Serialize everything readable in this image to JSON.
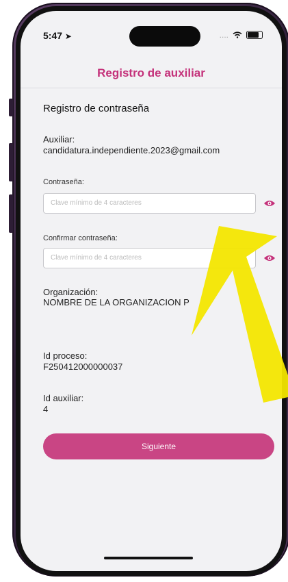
{
  "status_bar": {
    "time": "5:47",
    "signal": "....",
    "wifi": "wifi-icon",
    "battery": "battery-icon"
  },
  "header": {
    "title": "Registro de auxiliar"
  },
  "main": {
    "section_title": "Registro de contraseña",
    "auxiliar_label": "Auxiliar:",
    "auxiliar_value": "candidatura.independiente.2023@gmail.com",
    "password_label": "Contraseña:",
    "password_placeholder": "Clave mínimo de 4 caracteres",
    "confirm_label": "Confirmar contraseña:",
    "confirm_placeholder": "Clave mínimo de 4 caracteres",
    "organization_label": "Organización:",
    "organization_value": "NOMBRE DE LA ORGANIZACION P",
    "process_label": "Id proceso:",
    "process_value": "F250412000000037",
    "aux_id_label": "Id auxiliar:",
    "aux_id_value": "4",
    "next_button": "Siguiente"
  },
  "colors": {
    "accent": "#c94584",
    "title": "#c4317a",
    "arrow": "#f3e600"
  }
}
